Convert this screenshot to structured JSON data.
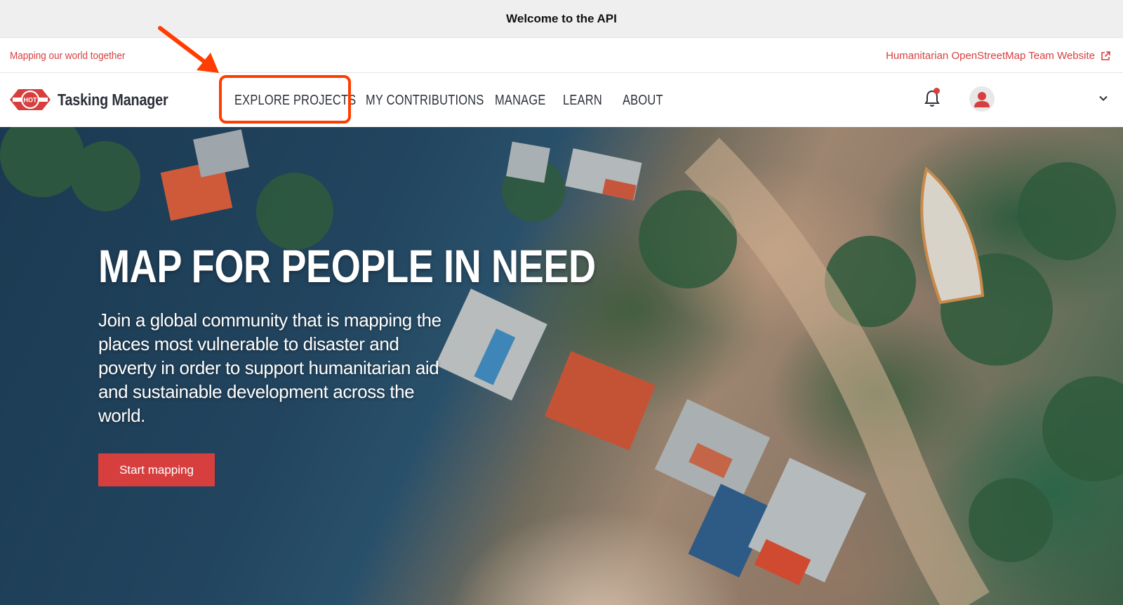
{
  "banner": {
    "text": "Welcome to the API"
  },
  "topbar": {
    "tagline": "Mapping our world together",
    "hot_link": "Humanitarian OpenStreetMap Team Website"
  },
  "navbar": {
    "logo_badge": "HOT",
    "logo_text": "Tasking Manager",
    "items": [
      {
        "label": "EXPLORE PROJECTS"
      },
      {
        "label": "MY CONTRIBUTIONS"
      },
      {
        "label": "MANAGE"
      },
      {
        "label": "LEARN"
      },
      {
        "label": "ABOUT"
      }
    ]
  },
  "hero": {
    "title": "MAP FOR PEOPLE IN NEED",
    "text": "Join a global community that is mapping the places most vulnerable to disaster and poverty in order to support humanitarian aid and sustainable development across the world.",
    "button": "Start mapping"
  },
  "colors": {
    "accent": "#d73f3f",
    "annotation": "#ff3d00",
    "nav_text": "#2c3038"
  },
  "icons": {
    "external": "external-link-icon",
    "notification": "bell-icon",
    "user": "user-avatar-icon",
    "dropdown": "chevron-down-icon"
  }
}
